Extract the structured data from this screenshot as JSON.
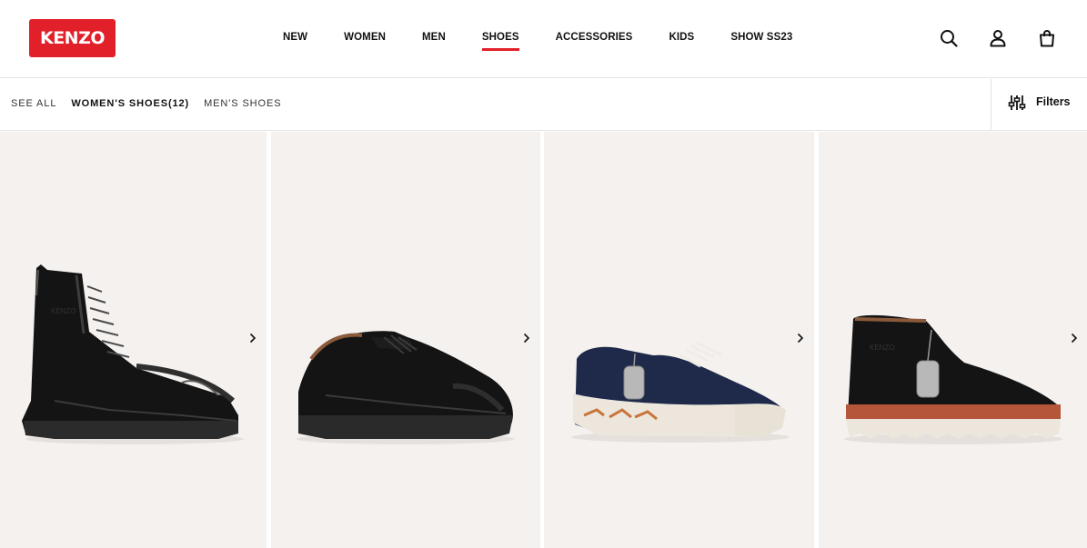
{
  "header": {
    "logo_text": "KENZO",
    "nav": [
      {
        "label": "NEW",
        "active": false
      },
      {
        "label": "WOMEN",
        "active": false
      },
      {
        "label": "MEN",
        "active": false
      },
      {
        "label": "SHOES",
        "active": true
      },
      {
        "label": "ACCESSORIES",
        "active": false
      },
      {
        "label": "KIDS",
        "active": false
      },
      {
        "label": "SHOW SS23",
        "active": false
      }
    ],
    "icons": [
      "search-icon",
      "account-icon",
      "bag-icon"
    ]
  },
  "subbar": {
    "see_all": "SEE ALL",
    "womens_shoes": "WOMEN'S SHOES(12)",
    "mens_shoes": "MEN'S SHOES",
    "filters_label": "Filters"
  },
  "products": [
    {
      "name": "black-leather-boot"
    },
    {
      "name": "black-leather-derby"
    },
    {
      "name": "navy-tiger-sneaker"
    },
    {
      "name": "black-suede-desert-boot"
    }
  ],
  "colors": {
    "brand_red": "#e2202a",
    "card_bg": "#f4f1ef"
  }
}
